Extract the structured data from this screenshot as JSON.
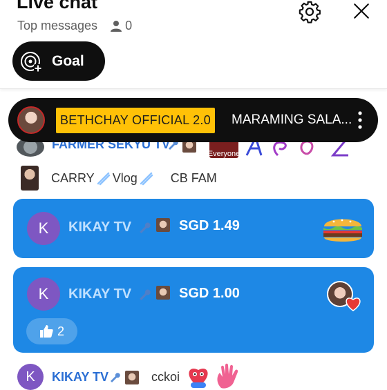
{
  "header": {
    "title": "Live chat",
    "mode_label": "Top messages",
    "viewer_count": "0",
    "goal_label": "Goal"
  },
  "pinned": {
    "author": "BETHCHAY OFFICIAL 2.0",
    "message": "MARAMING SALA..."
  },
  "partial_row": {
    "author": "FARMER SEKYU TV",
    "sticker_text": "Everyone"
  },
  "messages": [
    {
      "author": "CARRY",
      "author_suffix": "Vlog",
      "text": "CB FAM"
    }
  ],
  "super_chats": [
    {
      "avatar_letter": "K",
      "author": "KIKAY TV",
      "amount": "SGD 1.49",
      "sticker": "burger"
    },
    {
      "avatar_letter": "K",
      "author": "KIKAY TV",
      "amount": "SGD 1.00",
      "sticker": "heart-avatar",
      "likes": "2"
    }
  ],
  "last_message": {
    "avatar_letter": "K",
    "author": "KIKAY TV",
    "text": "cckoi"
  },
  "colors": {
    "superchat_bg": "#1e88e5",
    "pin_highlight": "#ffc107",
    "avatar_purple": "#7e57c2"
  }
}
